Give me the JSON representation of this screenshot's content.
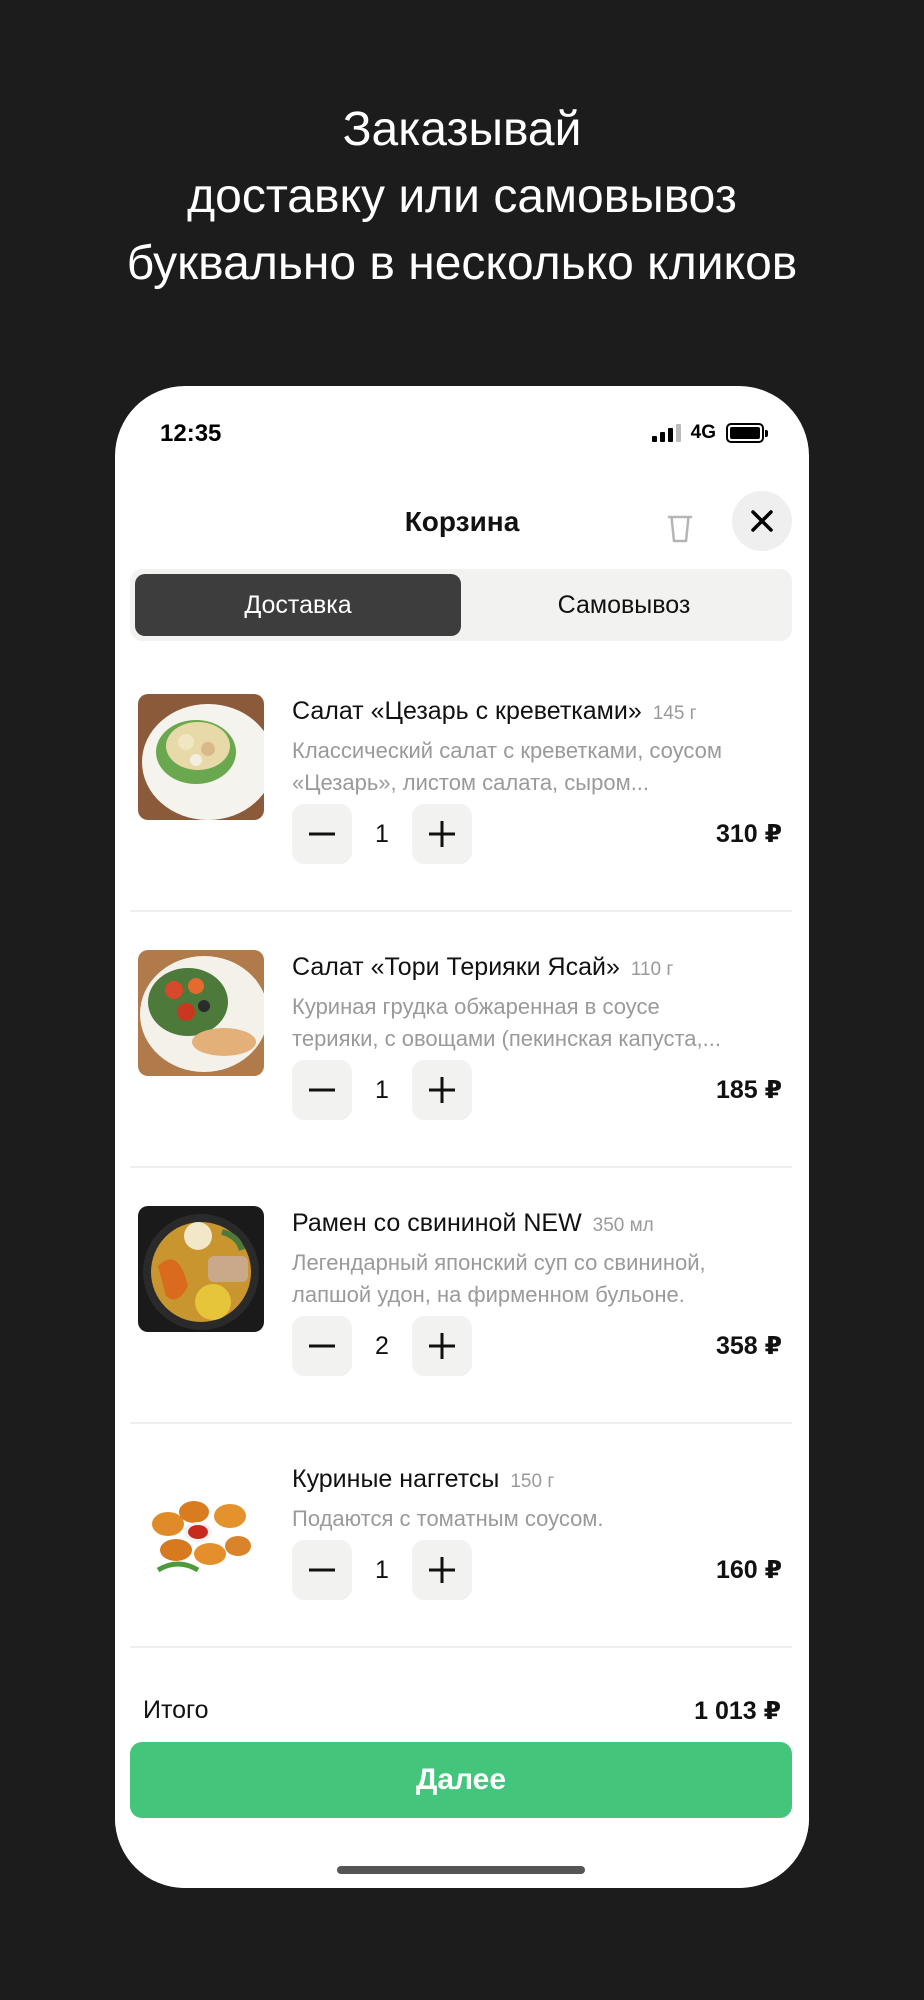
{
  "headline": {
    "line1": "Заказывай",
    "line2": "доставку или самовывоз",
    "line3": "буквально в несколько кликов"
  },
  "status_bar": {
    "time": "12:35",
    "network": "4G"
  },
  "header": {
    "title": "Корзина",
    "trash_icon": "trash-icon",
    "close_icon": "close-icon"
  },
  "tabs": [
    {
      "label": "Доставка",
      "active": true
    },
    {
      "label": "Самовывоз",
      "active": false
    }
  ],
  "items": [
    {
      "title": "Салат «Цезарь с креветками»",
      "weight": "145 г",
      "desc_line1": "Классический салат с креветками, соусом",
      "desc_line2": "«Цезарь», листом салата, сыром...",
      "qty": "1",
      "price": "310 ₽"
    },
    {
      "title": "Салат «Тори Терияки Ясай»",
      "weight": "110 г",
      "desc_line1": "Куриная грудка обжаренная в соусе",
      "desc_line2": "терияки, с овощами (пекинская капуста,...",
      "qty": "1",
      "price": "185 ₽"
    },
    {
      "title": "Рамен со свининой NEW",
      "weight": "350 мл",
      "desc_line1": "Легендарный японский суп со свининой,",
      "desc_line2": "лапшой удон, на фирменном бульоне.",
      "qty": "2",
      "price": "358 ₽"
    },
    {
      "title": "Куриные наггетсы",
      "weight": "150 г",
      "desc_line1": "Подаются с томатным соусом.",
      "desc_line2": "",
      "qty": "1",
      "price": "160 ₽"
    }
  ],
  "footer": {
    "total_label": "Итого",
    "total_value": "1 013 ₽",
    "next_label": "Далее"
  },
  "colors": {
    "background": "#1c1c1c",
    "accent": "#43c57b",
    "active_tab": "#3d3d3d"
  }
}
